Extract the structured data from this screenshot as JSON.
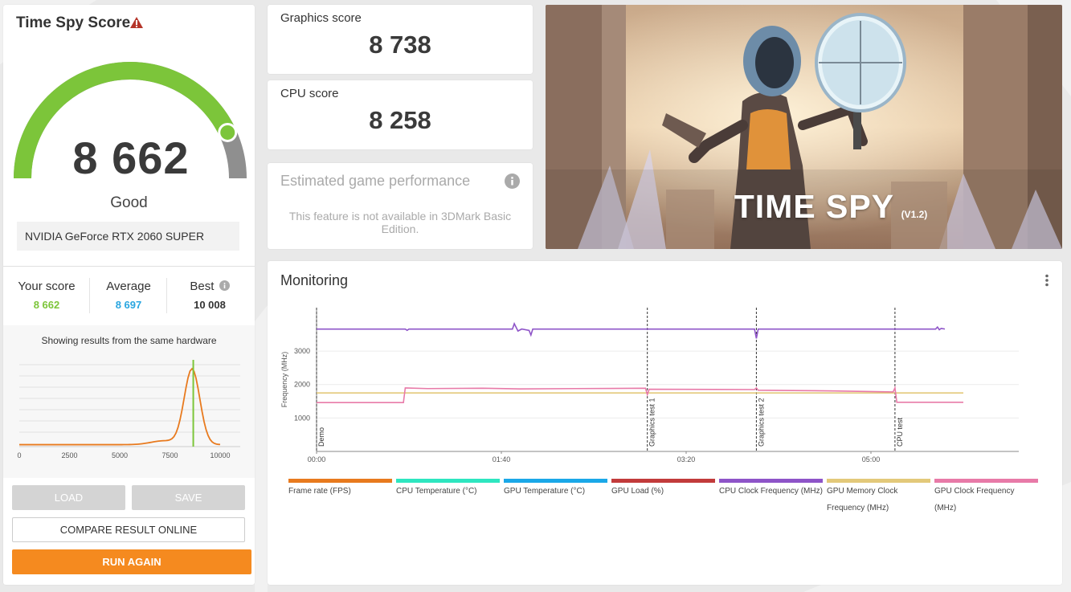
{
  "left_panel": {
    "title": "Time Spy Score",
    "score": "8 662",
    "gauge_fraction": 0.86,
    "rating": "Good",
    "gpu": "NVIDIA GeForce RTX 2060 SUPER",
    "stats": {
      "your_score_label": "Your score",
      "your_score_value": "8 662",
      "average_label": "Average",
      "average_value": "8 697",
      "best_label": "Best",
      "best_value": "10 008"
    },
    "showing_text": "Showing results from the same hardware",
    "histogram": {
      "x_ticks": [
        "0",
        "2500",
        "5000",
        "7500",
        "10000"
      ],
      "x_range": [
        0,
        11000
      ],
      "your_score": 8662
    },
    "buttons": {
      "load": "LOAD",
      "save": "SAVE",
      "compare": "COMPARE RESULT ONLINE",
      "run_again": "RUN AGAIN"
    }
  },
  "graphics_card": {
    "label": "Graphics score",
    "value": "8 738"
  },
  "cpu_card": {
    "label": "CPU score",
    "value": "8 258"
  },
  "egp_card": {
    "title": "Estimated game performance",
    "text": "This feature is not available in 3DMark Basic Edition."
  },
  "hero": {
    "title": "TIME SPY",
    "version": "(V1.2)"
  },
  "monitoring": {
    "title": "Monitoring",
    "y_label": "Frequency (MHz)",
    "y_ticks": [
      "1000",
      "2000",
      "3000"
    ],
    "x_ticks": [
      "00:00",
      "01:40",
      "03:20",
      "05:00"
    ],
    "markers": [
      "Demo",
      "Graphics test 1",
      "Graphics test 2",
      "CPU test"
    ],
    "legend": [
      {
        "label": "Frame rate (FPS)",
        "color": "#e87a1e"
      },
      {
        "label": "CPU Temperature (°C)",
        "color": "#2ee6c0"
      },
      {
        "label": "GPU Temperature (°C)",
        "color": "#1aa8e8"
      },
      {
        "label": "GPU Load (%)",
        "color": "#c23b3b"
      },
      {
        "label": "CPU Clock Frequency (MHz)",
        "color": "#8e54c8"
      },
      {
        "label": "GPU Memory Clock Frequency (MHz)",
        "color": "#e3c97a"
      },
      {
        "label": "GPU Clock Frequency (MHz)",
        "color": "#e87aa8"
      }
    ]
  },
  "colors": {
    "gauge_green": "#7cc53a",
    "average_blue": "#2aa6e0",
    "orange": "#f58a1f",
    "warning_red": "#b5352a"
  }
}
